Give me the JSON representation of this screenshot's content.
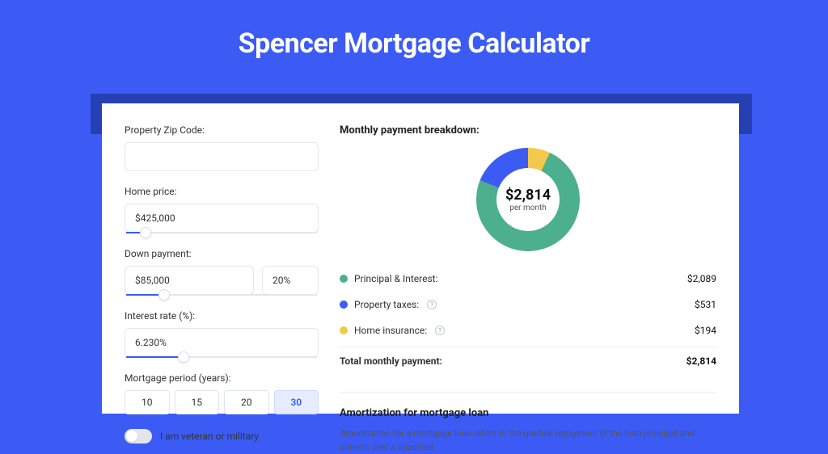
{
  "title": "Spencer Mortgage Calculator",
  "form": {
    "zip_label": "Property Zip Code:",
    "home_price_label": "Home price:",
    "home_price_value": "$425,000",
    "home_price_slider_pct": 10,
    "down_payment_label": "Down payment:",
    "down_payment_value": "$85,000",
    "down_payment_pct_value": "20%",
    "down_payment_slider_pct": 20,
    "interest_label": "Interest rate (%):",
    "interest_value": "6.230%",
    "interest_slider_pct": 30,
    "period_label": "Mortgage period (years):",
    "period_options": [
      "10",
      "15",
      "20",
      "30"
    ],
    "period_selected": "30",
    "veteran_label": "I am veteran or military"
  },
  "breakdown": {
    "title": "Monthly payment breakdown:",
    "donut_center_amount": "$2,814",
    "donut_center_sub": "per month",
    "items": [
      {
        "label": "Principal & Interest:",
        "amount": "$2,089",
        "color": "green",
        "info": false
      },
      {
        "label": "Property taxes:",
        "amount": "$531",
        "color": "blue",
        "info": true
      },
      {
        "label": "Home insurance:",
        "amount": "$194",
        "color": "yellow",
        "info": true
      }
    ],
    "total_label": "Total monthly payment:",
    "total_amount": "$2,814"
  },
  "amortization": {
    "title": "Amortization for mortgage loan",
    "text": "Amortization for a mortgage loan refers to the gradual repayment of the loan principal and interest over a specified"
  },
  "chart_data": {
    "type": "pie",
    "title": "Monthly payment breakdown",
    "series": [
      {
        "name": "Principal & Interest",
        "value": 2089,
        "color": "#4caf8e"
      },
      {
        "name": "Property taxes",
        "value": 531,
        "color": "#3b5bf4"
      },
      {
        "name": "Home insurance",
        "value": 194,
        "color": "#f2c94c"
      }
    ],
    "total": 2814,
    "unit": "USD per month"
  }
}
